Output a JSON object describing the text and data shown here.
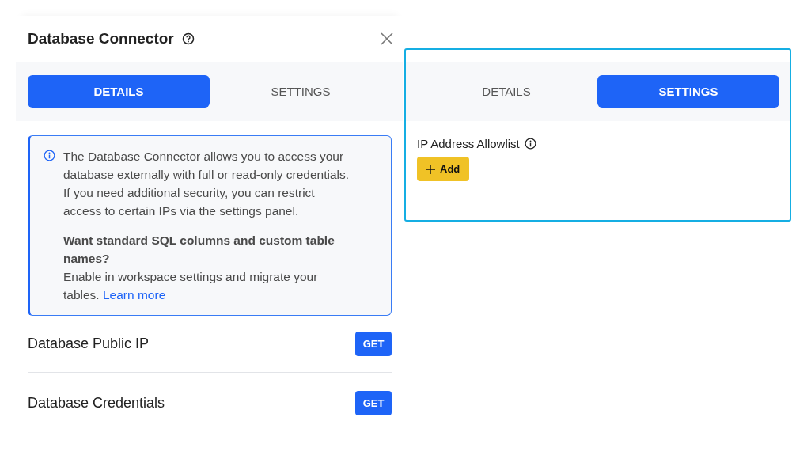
{
  "dialog": {
    "title": "Database Connector",
    "tabs": [
      {
        "label": "DETAILS",
        "selected": true
      },
      {
        "label": "SETTINGS",
        "selected": false
      }
    ],
    "info": {
      "paragraph": "The Database Connector allows you to access your database externally with full or read-only credentials. If you need additional security, you can restrict access to certain IPs via the settings panel.",
      "heading": "Want standard SQL columns and custom table names?",
      "body": "Enable in workspace settings and migrate your tables.",
      "link": "Learn more"
    },
    "rows": [
      {
        "label": "Database Public IP",
        "button": "GET"
      },
      {
        "label": "Database Credentials",
        "button": "GET"
      }
    ]
  },
  "settings_panel": {
    "tabs": [
      {
        "label": "DETAILS",
        "selected": false
      },
      {
        "label": "SETTINGS",
        "selected": true
      }
    ],
    "allowlist": {
      "label": "IP Address Allowlist",
      "button": "Add"
    }
  }
}
